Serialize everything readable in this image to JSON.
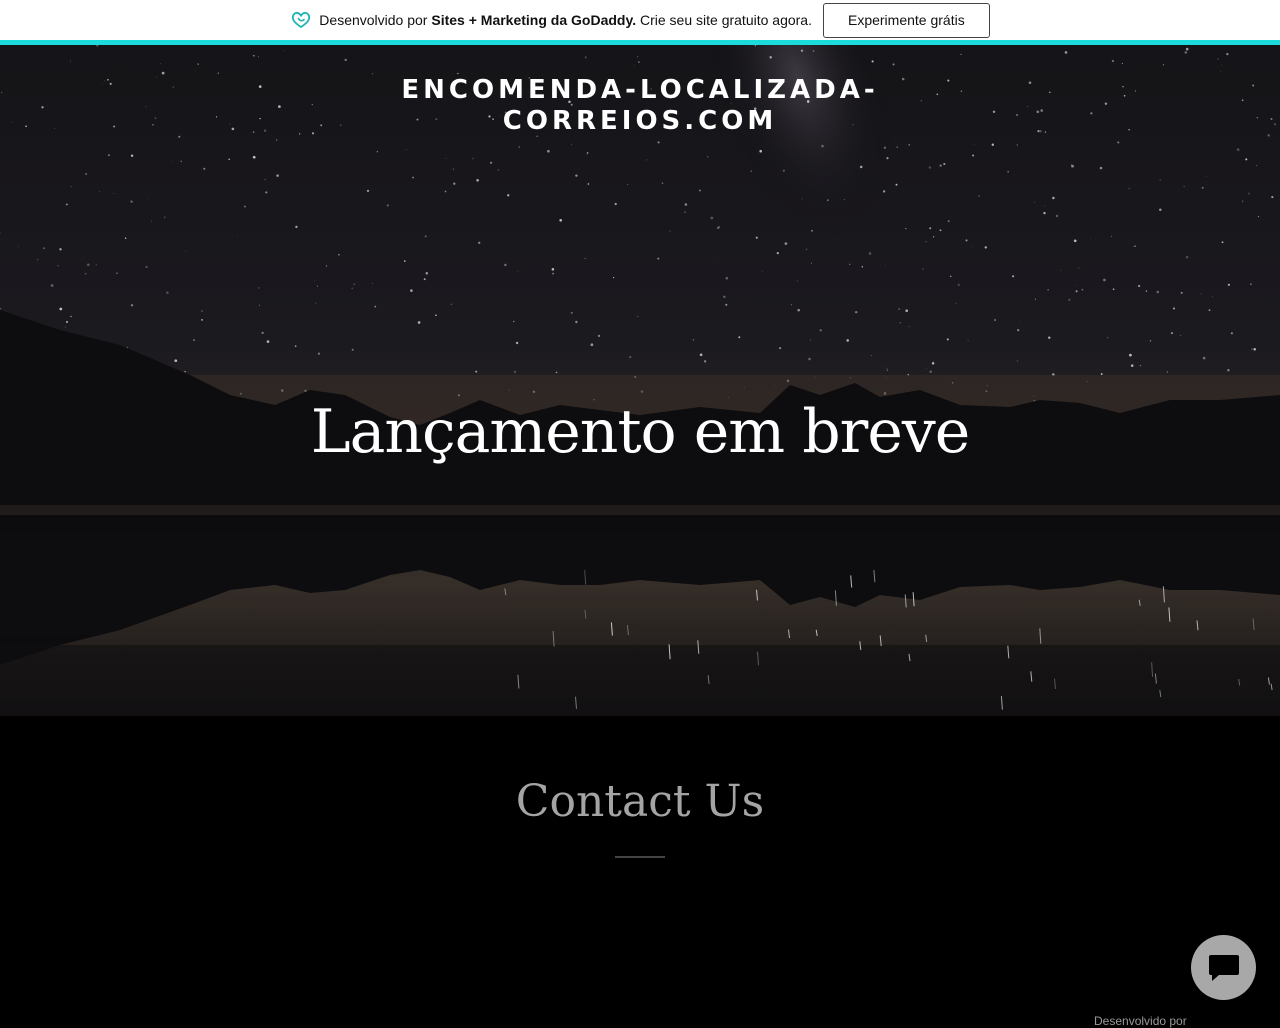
{
  "promo": {
    "prefix": "Desenvolvido por ",
    "brand": "Sites + Marketing da GoDaddy.",
    "suffix": " Crie seu site gratuito agora.",
    "button_label": "Experimente grátis",
    "logo_icon": "godaddy-heart-icon",
    "accent": "#1bdbdb"
  },
  "hero": {
    "site_title_line1": "ENCOMENDA-LOCALIZADA-",
    "site_title_line2": "CORREIOS.COM",
    "heading": "Lançamento em breve",
    "background": "starry-night-mountain-lake"
  },
  "contact": {
    "heading": "Contact Us"
  },
  "chat": {
    "icon": "chat-bubble-icon"
  },
  "footer": {
    "powered_by": "Desenvolvido por"
  }
}
